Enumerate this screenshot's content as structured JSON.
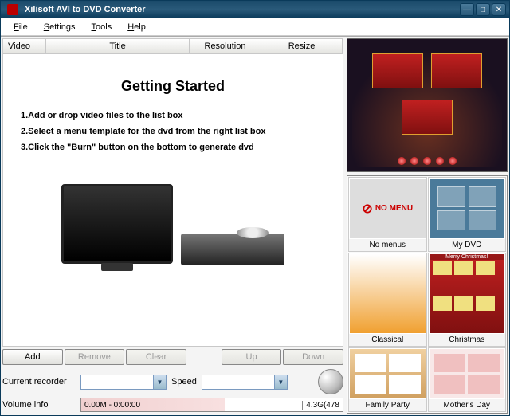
{
  "window": {
    "title": "Xilisoft AVI to DVD Converter"
  },
  "menubar": [
    "File",
    "Settings",
    "Tools",
    "Help"
  ],
  "list_cols": {
    "video": "Video",
    "title": "Title",
    "resolution": "Resolution",
    "resize": "Resize"
  },
  "getting_started": {
    "heading": "Getting Started",
    "step1": "1.Add or drop video files to the list box",
    "step2": "2.Select a menu template for the dvd from the right list box",
    "step3": "3.Click the \"Burn\" button on the bottom to generate dvd"
  },
  "buttons": {
    "add": "Add",
    "remove": "Remove",
    "clear": "Clear",
    "up": "Up",
    "down": "Down"
  },
  "settings": {
    "recorder_label": "Current recorder",
    "recorder_value": "",
    "speed_label": "Speed",
    "speed_value": ""
  },
  "volume": {
    "label": "Volume info",
    "left": "0.00M - 0:00:00",
    "right": "4.3G(478"
  },
  "templates": [
    {
      "label": "No menus",
      "kind": "nomenu"
    },
    {
      "label": "My DVD",
      "kind": "mydvd"
    },
    {
      "label": "Classical",
      "kind": "classical"
    },
    {
      "label": "Christmas",
      "kind": "xmas",
      "banner": "Merry Christmas!"
    },
    {
      "label": "Family Party",
      "kind": "family"
    },
    {
      "label": "Mother's Day",
      "kind": "mother"
    }
  ]
}
